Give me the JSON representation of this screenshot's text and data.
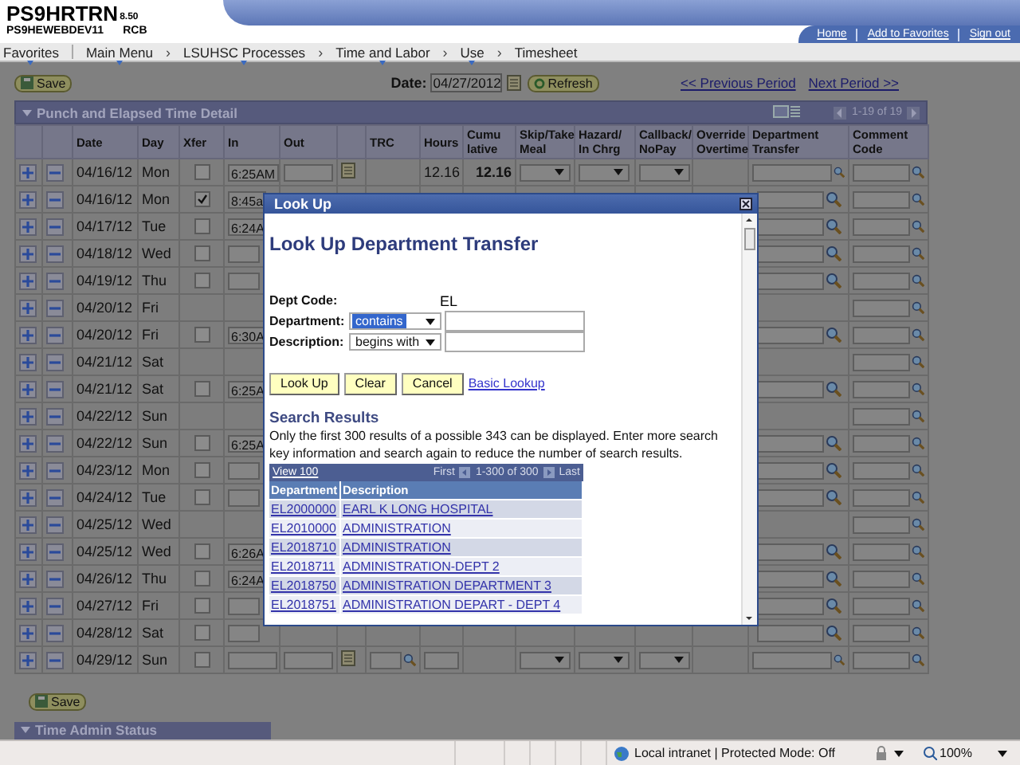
{
  "header": {
    "app_name": "PS9HRTRN",
    "version": "8.50",
    "server": "PS9HEWEBDEV11",
    "user": "RCB",
    "links": [
      "Home",
      "Add to Favorites",
      "Sign out"
    ]
  },
  "nav": [
    {
      "kind": "menu",
      "label": "Favorites"
    },
    {
      "kind": "menu",
      "label": "Main Menu"
    },
    {
      "kind": "sep",
      "label": "›"
    },
    {
      "kind": "menu",
      "label": "LSUHSC Processes"
    },
    {
      "kind": "sep",
      "label": "›"
    },
    {
      "kind": "menu",
      "label": "Time and Labor"
    },
    {
      "kind": "sep",
      "label": "›"
    },
    {
      "kind": "menu",
      "label": "Use"
    },
    {
      "kind": "sep",
      "label": "›"
    },
    {
      "kind": "crumb",
      "label": "Timesheet"
    }
  ],
  "toolbar": {
    "save": "Save",
    "date_label": "Date:",
    "date": "04/27/2012",
    "refresh": "Refresh",
    "prev": "<< Previous Period",
    "next": "Next Period >>"
  },
  "punch_panel": {
    "title": "Punch and Elapsed Time Detail",
    "range": "1-19 of 19",
    "columns": [
      "",
      "",
      "Date",
      "Day",
      "Xfer",
      "In",
      "Out",
      "",
      "TRC",
      "Hours",
      "Cumu lative",
      "Skip/Take Meal",
      "Hazard/ In Chrg",
      "Callback/ NoPay",
      "Override Overtime",
      "Department Transfer",
      "Comment Code"
    ],
    "rows": [
      {
        "kind": "punch",
        "date": "04/16/12",
        "day": "Mon",
        "xfer": false,
        "in": "6:25AM",
        "hours": "12.16",
        "cumulative": "12.16"
      },
      {
        "kind": "punch",
        "date": "04/16/12",
        "day": "Mon",
        "xfer": true,
        "in": "8:45a"
      },
      {
        "kind": "punch",
        "date": "04/17/12",
        "day": "Tue",
        "xfer": false,
        "in": "6:24A"
      },
      {
        "kind": "punch",
        "date": "04/18/12",
        "day": "Wed",
        "xfer": false
      },
      {
        "kind": "punch",
        "date": "04/19/12",
        "day": "Thu",
        "xfer": false
      },
      {
        "kind": "blank",
        "date": "04/20/12",
        "day": "Fri"
      },
      {
        "kind": "punch",
        "date": "04/20/12",
        "day": "Fri",
        "xfer": false,
        "in": "6:30A"
      },
      {
        "kind": "blank",
        "date": "04/21/12",
        "day": "Sat"
      },
      {
        "kind": "punch",
        "date": "04/21/12",
        "day": "Sat",
        "xfer": false,
        "in": "6:25A"
      },
      {
        "kind": "blank",
        "date": "04/22/12",
        "day": "Sun"
      },
      {
        "kind": "punch",
        "date": "04/22/12",
        "day": "Sun",
        "xfer": false,
        "in": "6:25A"
      },
      {
        "kind": "punch",
        "date": "04/23/12",
        "day": "Mon",
        "xfer": false
      },
      {
        "kind": "punch",
        "date": "04/24/12",
        "day": "Tue",
        "xfer": false
      },
      {
        "kind": "blank",
        "date": "04/25/12",
        "day": "Wed"
      },
      {
        "kind": "punch",
        "date": "04/25/12",
        "day": "Wed",
        "xfer": false,
        "in": "6:26A"
      },
      {
        "kind": "punch",
        "date": "04/26/12",
        "day": "Thu",
        "xfer": false,
        "in": "6:24A"
      },
      {
        "kind": "punch",
        "date": "04/27/12",
        "day": "Fri",
        "xfer": false
      },
      {
        "kind": "punch",
        "date": "04/28/12",
        "day": "Sat",
        "xfer": false
      },
      {
        "kind": "punch",
        "date": "04/29/12",
        "day": "Sun",
        "xfer": false
      }
    ]
  },
  "bottom": {
    "save": "Save",
    "panel_title": "Time Admin Status"
  },
  "lookup": {
    "title": "Look Up",
    "heading": "Look Up Department Transfer",
    "dept_code_label": "Dept Code:",
    "dept_code": "EL",
    "fields": [
      {
        "label": "Department:",
        "operator": "contains",
        "highlighted": true
      },
      {
        "label": "Description:",
        "operator": "begins with",
        "highlighted": false
      }
    ],
    "buttons": [
      "Look Up",
      "Clear",
      "Cancel"
    ],
    "basic_link": "Basic Lookup",
    "results_title": "Search Results",
    "results_note": "Only the first 300 results of a possible 343 can be displayed. Enter more search key information and search again to reduce the number of search results.",
    "grid": {
      "view": "View 100",
      "first": "First",
      "range": "1-300 of 300",
      "last": "Last",
      "columns": [
        "Department",
        "Description"
      ],
      "rows": [
        {
          "code": "EL2000000",
          "description": "EARL K LONG HOSPITAL"
        },
        {
          "code": "EL2010000",
          "description": "ADMINISTRATION"
        },
        {
          "code": "EL2018710",
          "description": "ADMINISTRATION"
        },
        {
          "code": "EL2018711",
          "description": "ADMINISTRATION-DEPT 2"
        },
        {
          "code": "EL2018750",
          "description": "ADMINISTRATION DEPARTMENT 3"
        },
        {
          "code": "EL2018751",
          "description": "ADMINISTRATION DEPART - DEPT 4"
        }
      ]
    }
  },
  "status_bar": {
    "zone": "Local intranet | Protected Mode: Off",
    "zoom": "100%"
  }
}
